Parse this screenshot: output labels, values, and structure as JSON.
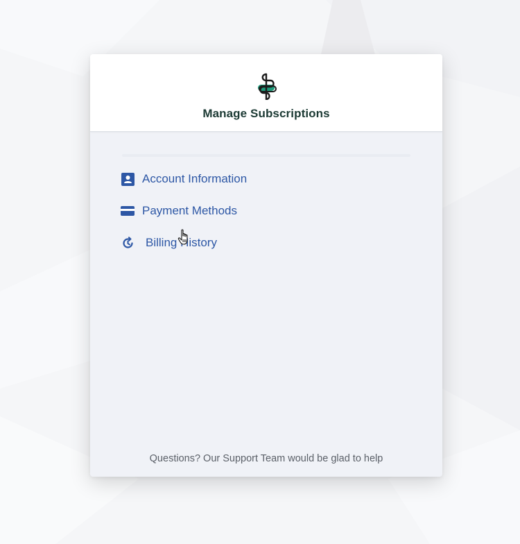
{
  "header": {
    "logo_icon": "stripe-s-logo",
    "title": "Manage Subscriptions"
  },
  "menu": {
    "items": [
      {
        "label": "Account Information",
        "icon": "account-card-icon"
      },
      {
        "label": "Payment Methods",
        "icon": "credit-card-icon"
      },
      {
        "label": "Billing History",
        "icon": "history-clock-icon"
      }
    ]
  },
  "footer": {
    "text": "Questions? Our Support Team would be glad to help"
  },
  "colors": {
    "accent": "#2d57a5",
    "title": "#1c3a34",
    "logo_green": "#1d9a7a",
    "panel_bg": "#f0f2f7"
  }
}
